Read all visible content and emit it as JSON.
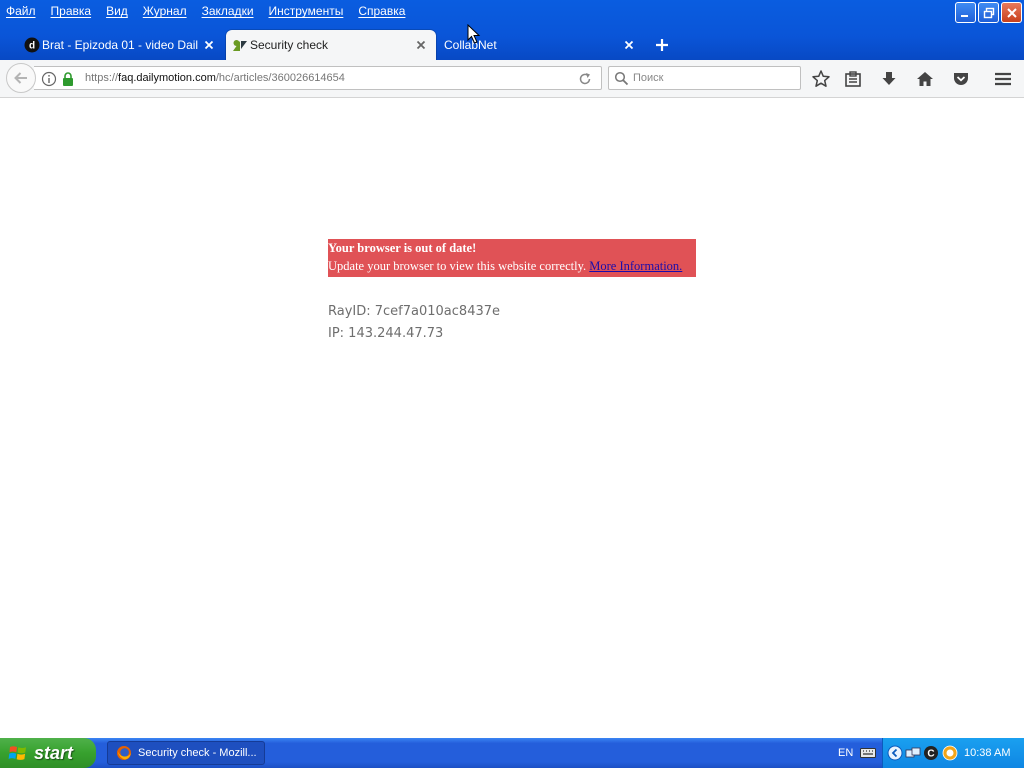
{
  "menubar": {
    "items": [
      "Файл",
      "Правка",
      "Вид",
      "Журнал",
      "Закладки",
      "Инструменты",
      "Справка"
    ]
  },
  "tabs": [
    {
      "label": "Brat - Epizoda 01 - video Dail...",
      "favicon": "dailymotion-icon",
      "active": false
    },
    {
      "label": "Security check",
      "favicon": "zendesk-icon",
      "active": true
    },
    {
      "label": "CollabNet",
      "favicon": "none",
      "active": false
    }
  ],
  "navbar": {
    "url_scheme": "https://",
    "url_host": "faq.dailymotion.com",
    "url_path": "/hc/articles/360026614654",
    "search_placeholder": "Поиск"
  },
  "page": {
    "alert_title": "Your browser is out of date!",
    "alert_body": "Update your browser to view this website correctly. ",
    "alert_link": "More Information.",
    "ray_id": "RayID: 7cef7a010ac8437e",
    "ip": "IP: 143.244.47.73"
  },
  "taskbar": {
    "start_label": "start",
    "task_label": "Security check - Mozill...",
    "language": "EN",
    "clock": "10:38 AM"
  },
  "colors": {
    "alert_background": "#e05256",
    "titlebar_blue": "#0a55d8",
    "start_green": "#37a12e",
    "link_color": "#1a0dab"
  }
}
